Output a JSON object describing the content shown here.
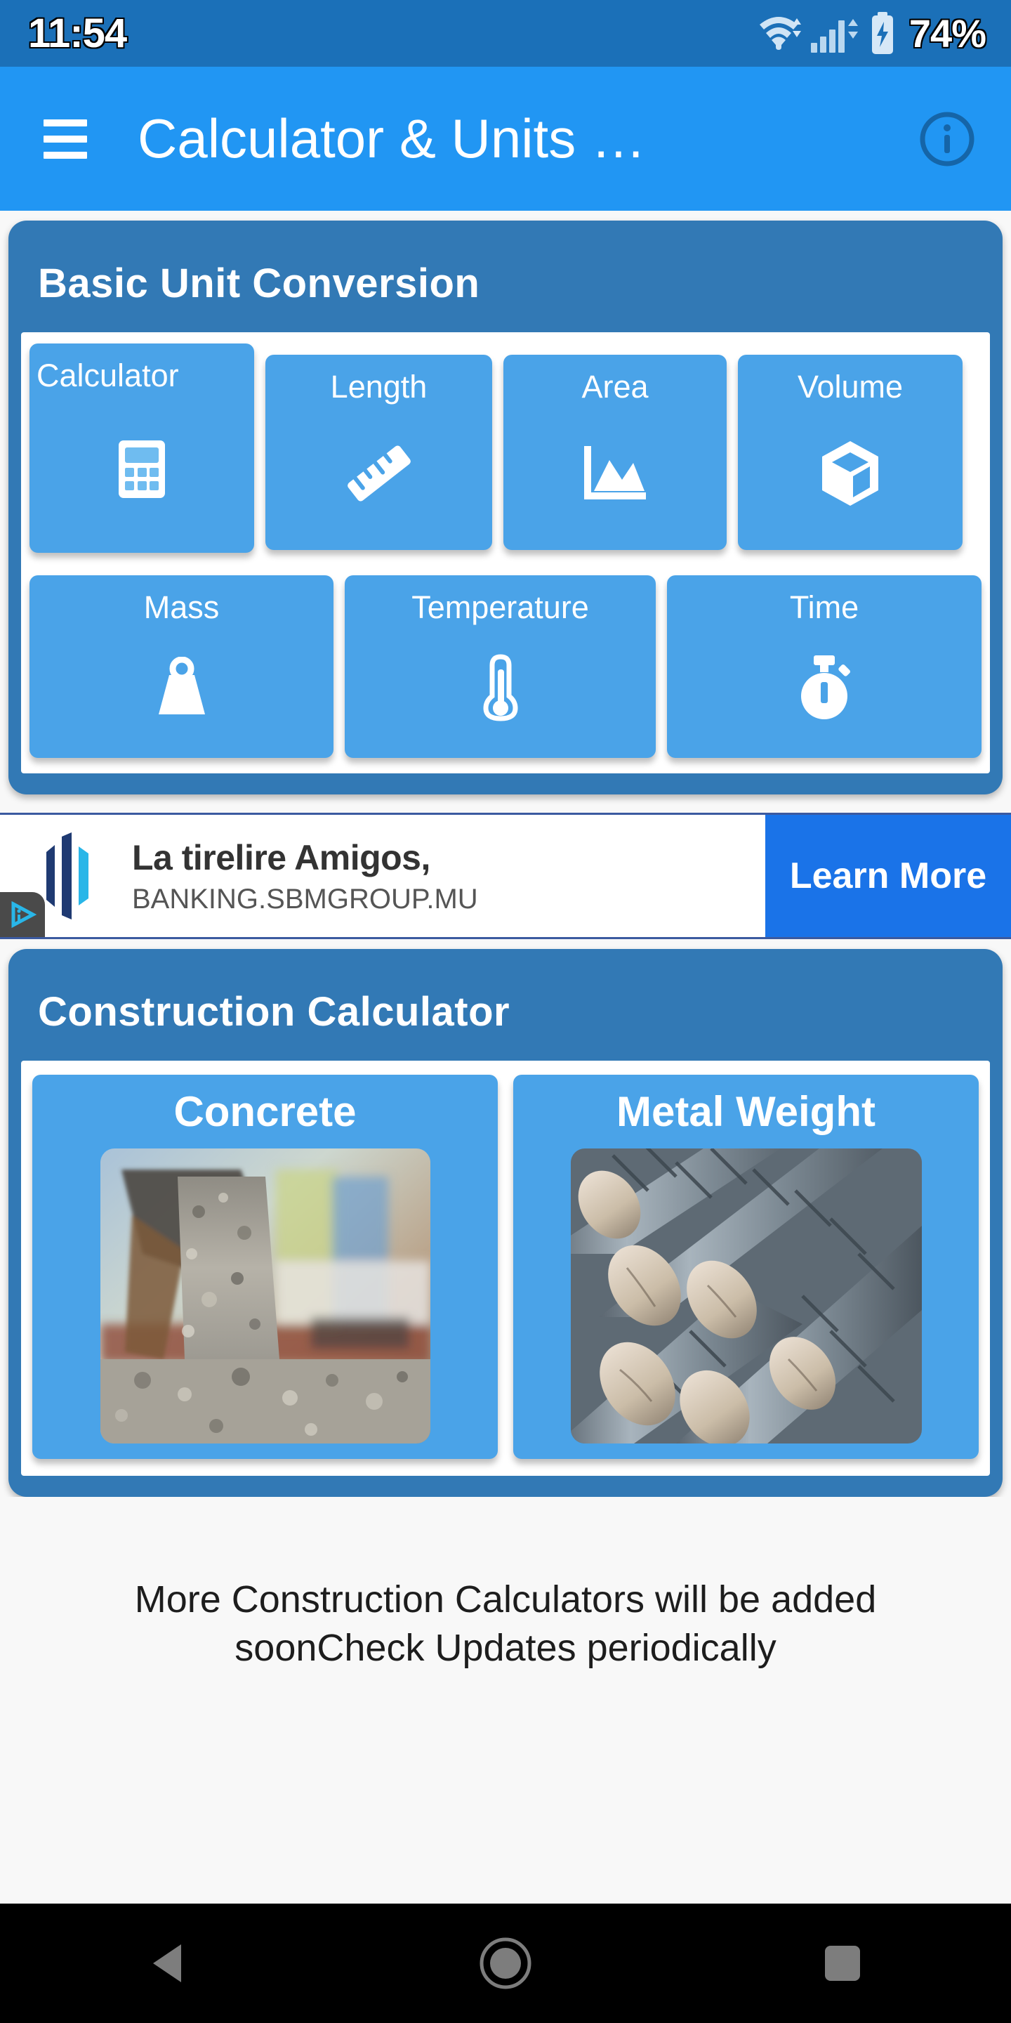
{
  "status_bar": {
    "clock": "11:54",
    "battery_percent": "74%",
    "icons": [
      "wifi-icon",
      "cellular-signal-icon",
      "battery-charging-icon"
    ],
    "background_color": "#1b70b8"
  },
  "app_bar": {
    "menu_icon": "hamburger-menu-icon",
    "title": "Calculator & Units …",
    "info_icon": "info-circle-icon",
    "background_color": "#2196f3"
  },
  "sections": [
    {
      "id": "basic-unit-conversion",
      "title": "Basic Unit Conversion",
      "header_color": "#3279b5",
      "tile_color": "#4aa3e8",
      "rows": [
        [
          {
            "label": "Calculator",
            "icon": "calculator-icon"
          },
          {
            "label": "Length",
            "icon": "ruler-icon"
          },
          {
            "label": "Area",
            "icon": "area-chart-icon"
          },
          {
            "label": "Volume",
            "icon": "cube-icon"
          }
        ],
        [
          {
            "label": "Mass",
            "icon": "weight-icon"
          },
          {
            "label": "Temperature",
            "icon": "thermometer-icon"
          },
          {
            "label": "Time",
            "icon": "stopwatch-icon"
          }
        ]
      ]
    }
  ],
  "advertisement": {
    "headline": "La tirelire Amigos,",
    "url": "BANKING.SBMGROUP.MU",
    "cta_label": "Learn More",
    "cta_color": "#1a73e8",
    "logo_icon": "sbm-bank-logo-icon",
    "adchoices_icon": "adchoices-icon",
    "logo_colors": [
      "#1f3a72",
      "#1f3a72",
      "#29b6e8"
    ]
  },
  "construction": {
    "title": "Construction Calculator",
    "header_color": "#3279b5",
    "tiles": [
      {
        "label": "Concrete",
        "image": "concrete-pour-photo"
      },
      {
        "label": "Metal Weight",
        "image": "steel-rebar-photo"
      }
    ]
  },
  "footer_note": "More Construction Calculators will be added soonCheck Updates periodically",
  "nav_bar": {
    "background_color": "#000000",
    "buttons": [
      {
        "name": "back",
        "icon": "back-triangle-icon"
      },
      {
        "name": "home",
        "icon": "home-circle-icon"
      },
      {
        "name": "recents",
        "icon": "recents-square-icon"
      }
    ]
  }
}
